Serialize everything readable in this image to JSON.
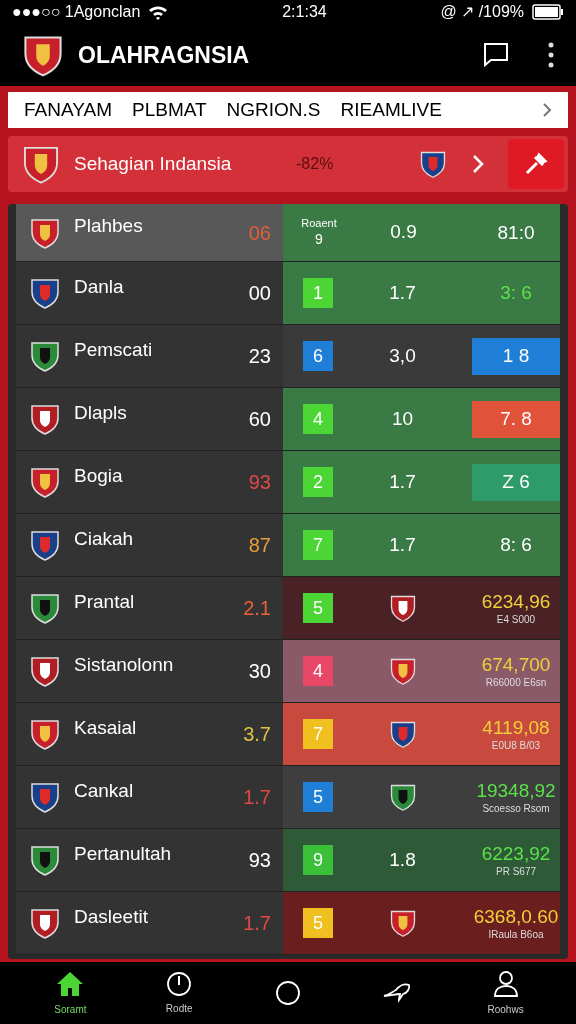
{
  "status_bar": {
    "carrier": "●●●○○ 1Agonclan",
    "time": "2:1:34",
    "indicators": "@ ↗ /109%"
  },
  "header": {
    "title": "OLAHRAGNSIA"
  },
  "tabs": [
    {
      "label": "FANAYAM",
      "selected": false
    },
    {
      "label": "PLBMAT",
      "selected": false
    },
    {
      "label": "NGRION.S",
      "selected": false
    },
    {
      "label": "RIEAMLIVE",
      "selected": false
    }
  ],
  "banner": {
    "title": "Sehagian Indansia",
    "value": "-82%"
  },
  "rows": [
    {
      "kind": "top",
      "name": "Plahbes",
      "score": {
        "text": "06",
        "color": "#e0603a"
      },
      "panel": {
        "color": "#3a7a45"
      },
      "top_label": "Roaent",
      "top_value": "9",
      "middle": "0.9",
      "result": {
        "text": "81:0",
        "color": "#ffffff"
      }
    },
    {
      "kind": "standard",
      "name": "Danla",
      "score": {
        "text": "00",
        "color": "#ffffff"
      },
      "panel": {
        "color": "#3a7a45"
      },
      "badge": {
        "text": "1",
        "color": "#4cd636"
      },
      "middle": "1.7",
      "result": {
        "text": "3: 6",
        "color": "#5be04a"
      }
    },
    {
      "kind": "standard",
      "name": "Pemscati",
      "score": {
        "text": "23",
        "color": "#ffffff"
      },
      "panel": {
        "color": "#3a3a3a"
      },
      "badge": {
        "text": "6",
        "color": "#1f7fd6"
      },
      "middle": "3,0",
      "result": {
        "text": "1 8",
        "color": "#ffffff",
        "box": {
          "color": "#1f7fd6"
        }
      }
    },
    {
      "kind": "standard",
      "name": "Dlapls",
      "score": {
        "text": "60",
        "color": "#ffffff"
      },
      "panel": {
        "color": "#3a7a45"
      },
      "badge": {
        "text": "4",
        "color": "#4cd636"
      },
      "middle": "10",
      "result": {
        "text": "7. 8",
        "color": "#ffffff",
        "box": {
          "color": "#e0533a"
        }
      }
    },
    {
      "kind": "standard",
      "name": "Bogia",
      "score": {
        "text": "93",
        "color": "#e04848"
      },
      "panel": {
        "color": "#3a7a45"
      },
      "badge": {
        "text": "2",
        "color": "#4cd636"
      },
      "middle": "1.7",
      "result": {
        "text": "Z 6",
        "color": "#ffffff",
        "box": {
          "color": "#2f9a6a"
        }
      }
    },
    {
      "kind": "standard",
      "name": "Ciakah",
      "score": {
        "text": "87",
        "color": "#e8a03a"
      },
      "panel": {
        "color": "#3a7a45"
      },
      "badge": {
        "text": "7",
        "color": "#4cd636"
      },
      "middle": "1.7",
      "result": {
        "text": "8: 6",
        "color": "#ffffff"
      }
    },
    {
      "kind": "crest",
      "name": "Prantal",
      "score": {
        "text": "2.1",
        "color": "#e8603a"
      },
      "panel": {
        "color": "#4a2226"
      },
      "badge": {
        "text": "5",
        "color": "#4cd636"
      },
      "result": {
        "text": "6234,96",
        "color": "#f0d03a"
      },
      "sub": "E4 S000"
    },
    {
      "kind": "crest",
      "name": "Sistanolonn",
      "score": {
        "text": "30",
        "color": "#ffffff"
      },
      "panel": {
        "color": "#8a5a68"
      },
      "badge": {
        "text": "4",
        "color": "#e84868"
      },
      "result": {
        "text": "674,700",
        "color": "#f0d03a"
      },
      "sub": "R66000 E6sn"
    },
    {
      "kind": "crest",
      "name": "Kasaial",
      "score": {
        "text": "3.7",
        "color": "#e0c040"
      },
      "panel": {
        "color": "#c84a3e"
      },
      "badge": {
        "text": "7",
        "color": "#f0c020"
      },
      "result": {
        "text": "4119,08",
        "color": "#f0d03a"
      },
      "sub": "E0U8 B/03"
    },
    {
      "kind": "crest",
      "name": "Cankal",
      "score": {
        "text": "1.7",
        "color": "#e04848"
      },
      "panel": {
        "color": "#3e3e3e"
      },
      "badge": {
        "text": "5",
        "color": "#1f7fd6"
      },
      "result": {
        "text": "19348,92",
        "color": "#5be04a"
      },
      "sub": "Scoesso Rsom"
    },
    {
      "kind": "standard",
      "name": "Pertanultah",
      "score": {
        "text": "93",
        "color": "#ffffff"
      },
      "panel": {
        "color": "#2e5a38"
      },
      "badge": {
        "text": "9",
        "color": "#3cc03a"
      },
      "middle": "1.8",
      "result": {
        "text": "6223,92",
        "color": "#5be04a"
      },
      "sub": "PR S677"
    },
    {
      "kind": "crest",
      "name": "Dasleetit",
      "score": {
        "text": "1.7",
        "color": "#e04848"
      },
      "panel": {
        "color": "#6a1e1e"
      },
      "badge": {
        "text": "5",
        "color": "#f0c020"
      },
      "result": {
        "text": "6368,0.60",
        "color": "#f0d03a"
      },
      "sub": "IRaula B6oa"
    }
  ],
  "bottom_nav": [
    {
      "kind": "home",
      "label": "Soramt",
      "selected": true
    },
    {
      "kind": "timer",
      "label": "Rodte",
      "selected": false
    },
    {
      "kind": "circle",
      "selected": false
    },
    {
      "kind": "bird",
      "selected": false
    },
    {
      "kind": "person",
      "label": "Roohws",
      "selected": false
    }
  ]
}
